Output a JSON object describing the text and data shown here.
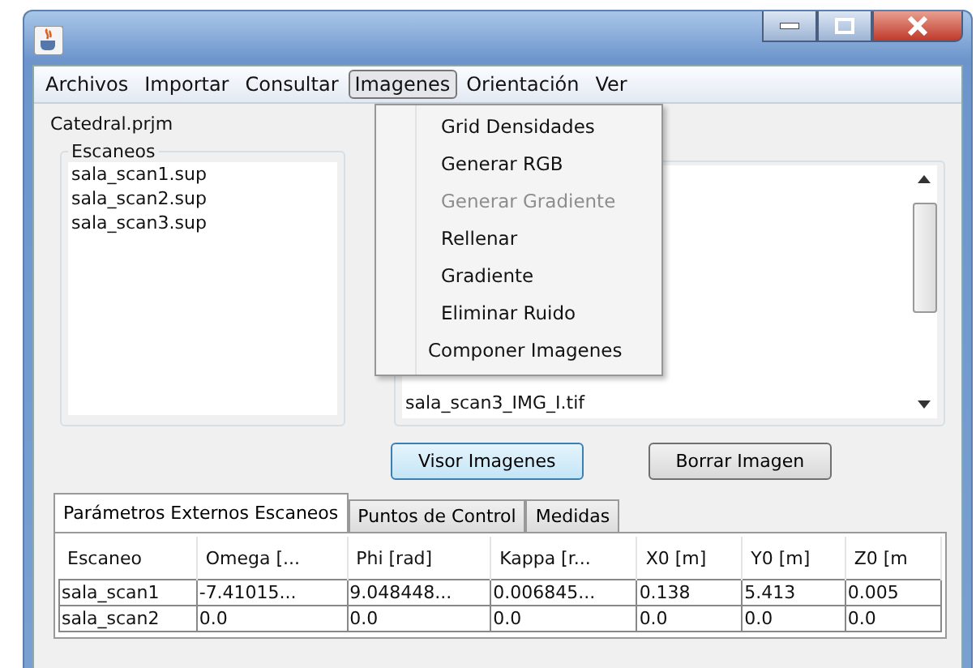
{
  "menubar": [
    {
      "label": "Archivos",
      "selected": false
    },
    {
      "label": "Importar",
      "selected": false
    },
    {
      "label": "Consultar",
      "selected": false
    },
    {
      "label": "Imagenes",
      "selected": true
    },
    {
      "label": "Orientación",
      "selected": false
    },
    {
      "label": "Ver",
      "selected": false
    }
  ],
  "project": "Catedral.prjm",
  "scans_group": {
    "title": "Escaneos",
    "items": [
      "sala_scan1.sup",
      "sala_scan2.sup",
      "sala_scan3.sup"
    ]
  },
  "images_list": {
    "items": [
      "sala_scan3_IMG_I.tif"
    ]
  },
  "menu": [
    {
      "label": "Grid Densidades",
      "disabled": false
    },
    {
      "label": "Generar RGB",
      "disabled": false
    },
    {
      "label": "Generar Gradiente",
      "disabled": true
    },
    {
      "label": "Rellenar",
      "disabled": false
    },
    {
      "label": "Gradiente",
      "disabled": false
    },
    {
      "label": "Eliminar Ruido",
      "disabled": false
    },
    {
      "label": "Componer Imagenes",
      "disabled": false
    }
  ],
  "buttons": [
    {
      "label": "Visor Imagenes",
      "selected": true
    },
    {
      "label": "Borrar Imagen",
      "selected": false
    }
  ],
  "tabs": [
    {
      "label": "Parámetros Externos Escaneos",
      "selected": true
    },
    {
      "label": "Puntos de Control",
      "selected": false
    },
    {
      "label": "Medidas",
      "selected": false
    }
  ],
  "table": {
    "columns": [
      "Escaneo",
      "Omega [...",
      "Phi [rad]",
      "Kappa [r...",
      "X0 [m]",
      "Y0 [m]",
      "Z0 [m"
    ],
    "rows": [
      [
        "sala_scan1",
        "-7.41015...",
        "9.048448...",
        "0.006845...",
        "0.138",
        "5.413",
        "0.005"
      ],
      [
        "sala_scan2",
        "0.0",
        "0.0",
        "0.0",
        "0.0",
        "0.0",
        "0.0"
      ]
    ]
  }
}
